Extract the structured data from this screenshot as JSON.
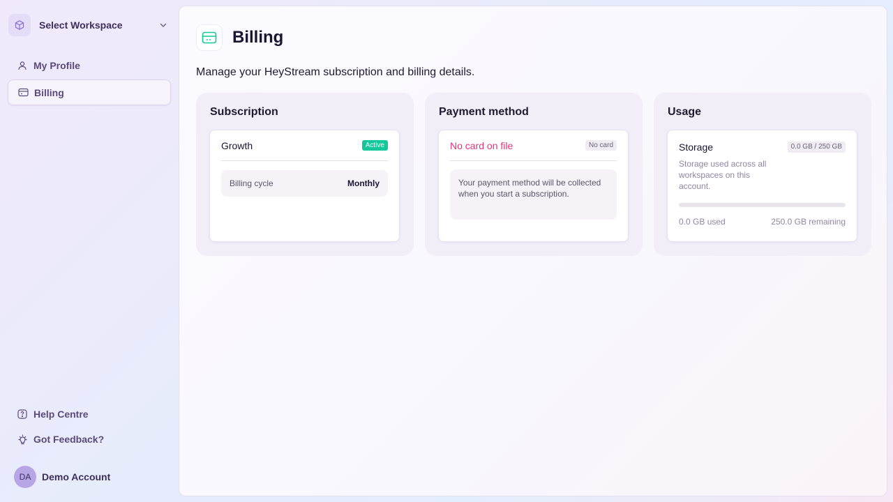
{
  "sidebar": {
    "workspace_label": "Select Workspace",
    "items": [
      {
        "label": "My Profile",
        "icon": "user-icon"
      },
      {
        "label": "Billing",
        "icon": "credit-card-icon"
      }
    ],
    "help_label": "Help Centre",
    "feedback_label": "Got Feedback?",
    "account": {
      "initials": "DA",
      "name": "Demo Account"
    }
  },
  "main": {
    "title": "Billing",
    "description": "Manage your HeyStream subscription and billing details.",
    "subscription": {
      "title": "Subscription",
      "plan": "Growth",
      "status": "Active",
      "cycle_label": "Billing cycle",
      "cycle_value": "Monthly"
    },
    "payment": {
      "title": "Payment method",
      "status_text": "No card on file",
      "badge": "No card",
      "note": "Your payment method will be collected when you start a subscription."
    },
    "usage": {
      "title": "Usage",
      "storage_title": "Storage",
      "storage_badge": "0.0 GB / 250 GB",
      "storage_desc": "Storage used across all workspaces on this account.",
      "used_label": "0.0 GB used",
      "remaining_label": "250.0 GB remaining",
      "used_fraction": 0
    }
  },
  "colors": {
    "accent": "#12c79a",
    "danger": "#e8307a",
    "sidebar_text": "#5a4a7a"
  }
}
